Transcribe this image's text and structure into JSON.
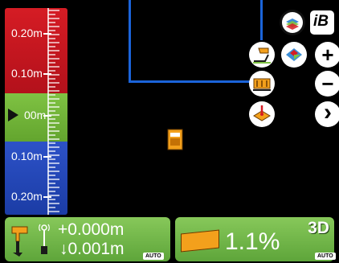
{
  "scale": {
    "labels_above": [
      "0.20m",
      "0.10m"
    ],
    "on_grade": "00m",
    "labels_below": [
      "0.10m",
      "0.20m"
    ]
  },
  "status": {
    "elevation_offset": "+0.000m",
    "tolerance": "↓0.001m",
    "left_mode": "AUTO",
    "slope": "1.1%",
    "view_mode": "3D",
    "right_mode": "AUTO"
  },
  "icons": {
    "brand": "iB",
    "zoom_in": "+",
    "zoom_out": "−",
    "next": "›"
  },
  "colors": {
    "above_grade": "#d51c24",
    "on_grade": "#7fc243",
    "below_grade": "#2d52c8",
    "panel": "#6fb447",
    "accent_line": "#1b64d9"
  }
}
